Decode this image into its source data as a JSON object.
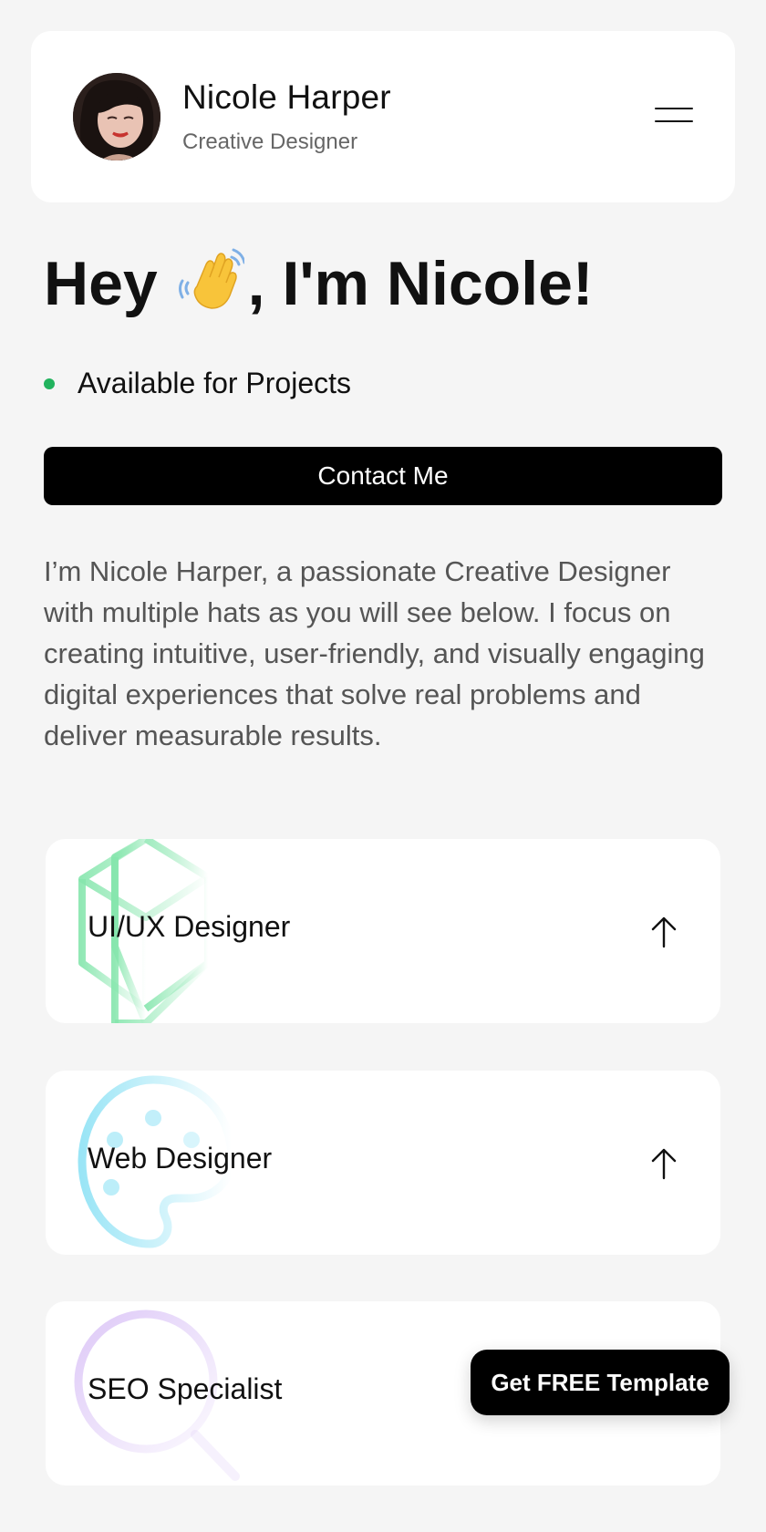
{
  "profile": {
    "name": "Nicole Harper",
    "role": "Creative Designer"
  },
  "hero": {
    "prefix": "Hey",
    "emoji": "waving-hand-icon",
    "suffix": ", I'm Nicole!"
  },
  "status": {
    "text": "Available for Projects",
    "color": "#22b35e"
  },
  "contact_button": "Contact Me",
  "bio": "I’m Nicole Harper, a passionate Creative Designer with multiple hats as you will see below. I focus on creating intuitive, user-friendly, and visually engaging digital experiences that solve real problems and deliver measurable results.",
  "services": [
    {
      "label": "UI/UX Designer",
      "icon": "cube-icon",
      "color": "#86e6ad"
    },
    {
      "label": "Web Designer",
      "icon": "palette-icon",
      "color": "#8fe2f5"
    },
    {
      "label": "SEO Specialist",
      "icon": "magnifier-icon",
      "color": "#dcc6f7"
    }
  ],
  "cta_button": "Get FREE Template"
}
